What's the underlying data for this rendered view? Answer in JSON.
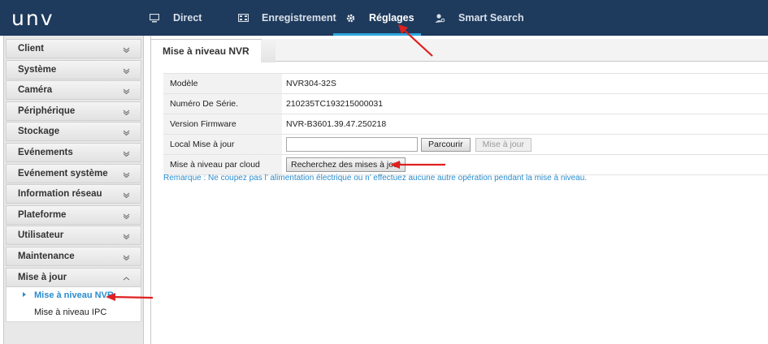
{
  "app": {
    "logo": "unv"
  },
  "top_nav": [
    {
      "label": "Direct",
      "icon": "monitor-icon",
      "active": false
    },
    {
      "label": "Enregistrement",
      "icon": "film-icon",
      "active": false
    },
    {
      "label": "Réglages",
      "icon": "gear-icon",
      "active": true
    },
    {
      "label": "Smart Search",
      "icon": "person-search-icon",
      "active": false
    }
  ],
  "sidebar": {
    "items": [
      {
        "label": "Client",
        "icon": "chevron-down-icon"
      },
      {
        "label": "Système",
        "icon": "chevron-down-icon"
      },
      {
        "label": "Caméra",
        "icon": "chevron-down-icon"
      },
      {
        "label": "Périphérique",
        "icon": "chevron-down-icon"
      },
      {
        "label": "Stockage",
        "icon": "chevron-down-icon"
      },
      {
        "label": "Evénements",
        "icon": "chevron-down-icon"
      },
      {
        "label": "Evénement système",
        "icon": "chevron-down-icon"
      },
      {
        "label": "Information réseau",
        "icon": "chevron-down-icon"
      },
      {
        "label": "Plateforme",
        "icon": "chevron-down-icon"
      },
      {
        "label": "Utilisateur",
        "icon": "chevron-down-icon"
      },
      {
        "label": "Maintenance",
        "icon": "chevron-down-icon"
      },
      {
        "label": "Mise à jour",
        "icon": "chevron-up-icon",
        "expanded": true
      }
    ],
    "sub_items": [
      {
        "label": "Mise à niveau NVR",
        "active": true
      },
      {
        "label": "Mise à niveau IPC",
        "active": false
      }
    ]
  },
  "main": {
    "tab_label": "Mise à niveau NVR",
    "rows": [
      {
        "label": "Modèle",
        "value": "NVR304-32S"
      },
      {
        "label": "Numéro De Série.",
        "value": "210235TC193215000031"
      },
      {
        "label": "Version Firmware",
        "value": "NVR-B3601.39.47.250218"
      }
    ],
    "local_upgrade": {
      "label": "Local Mise à jour",
      "input_value": "",
      "browse_label": "Parcourir",
      "upgrade_label": "Mise à jour"
    },
    "cloud_upgrade": {
      "label": "Mise à niveau par cloud",
      "button_label": "Recherchez des mises à jour"
    },
    "remark": "Remarque : Ne coupez pas l’ alimentation électrique ou n’ effectuez aucune autre opération pendant la mise à niveau."
  },
  "colors": {
    "topbar": "#1e3a5c",
    "accent": "#2ea8e0",
    "link": "#2a8ccd",
    "annotation_arrow": "#e02020"
  }
}
